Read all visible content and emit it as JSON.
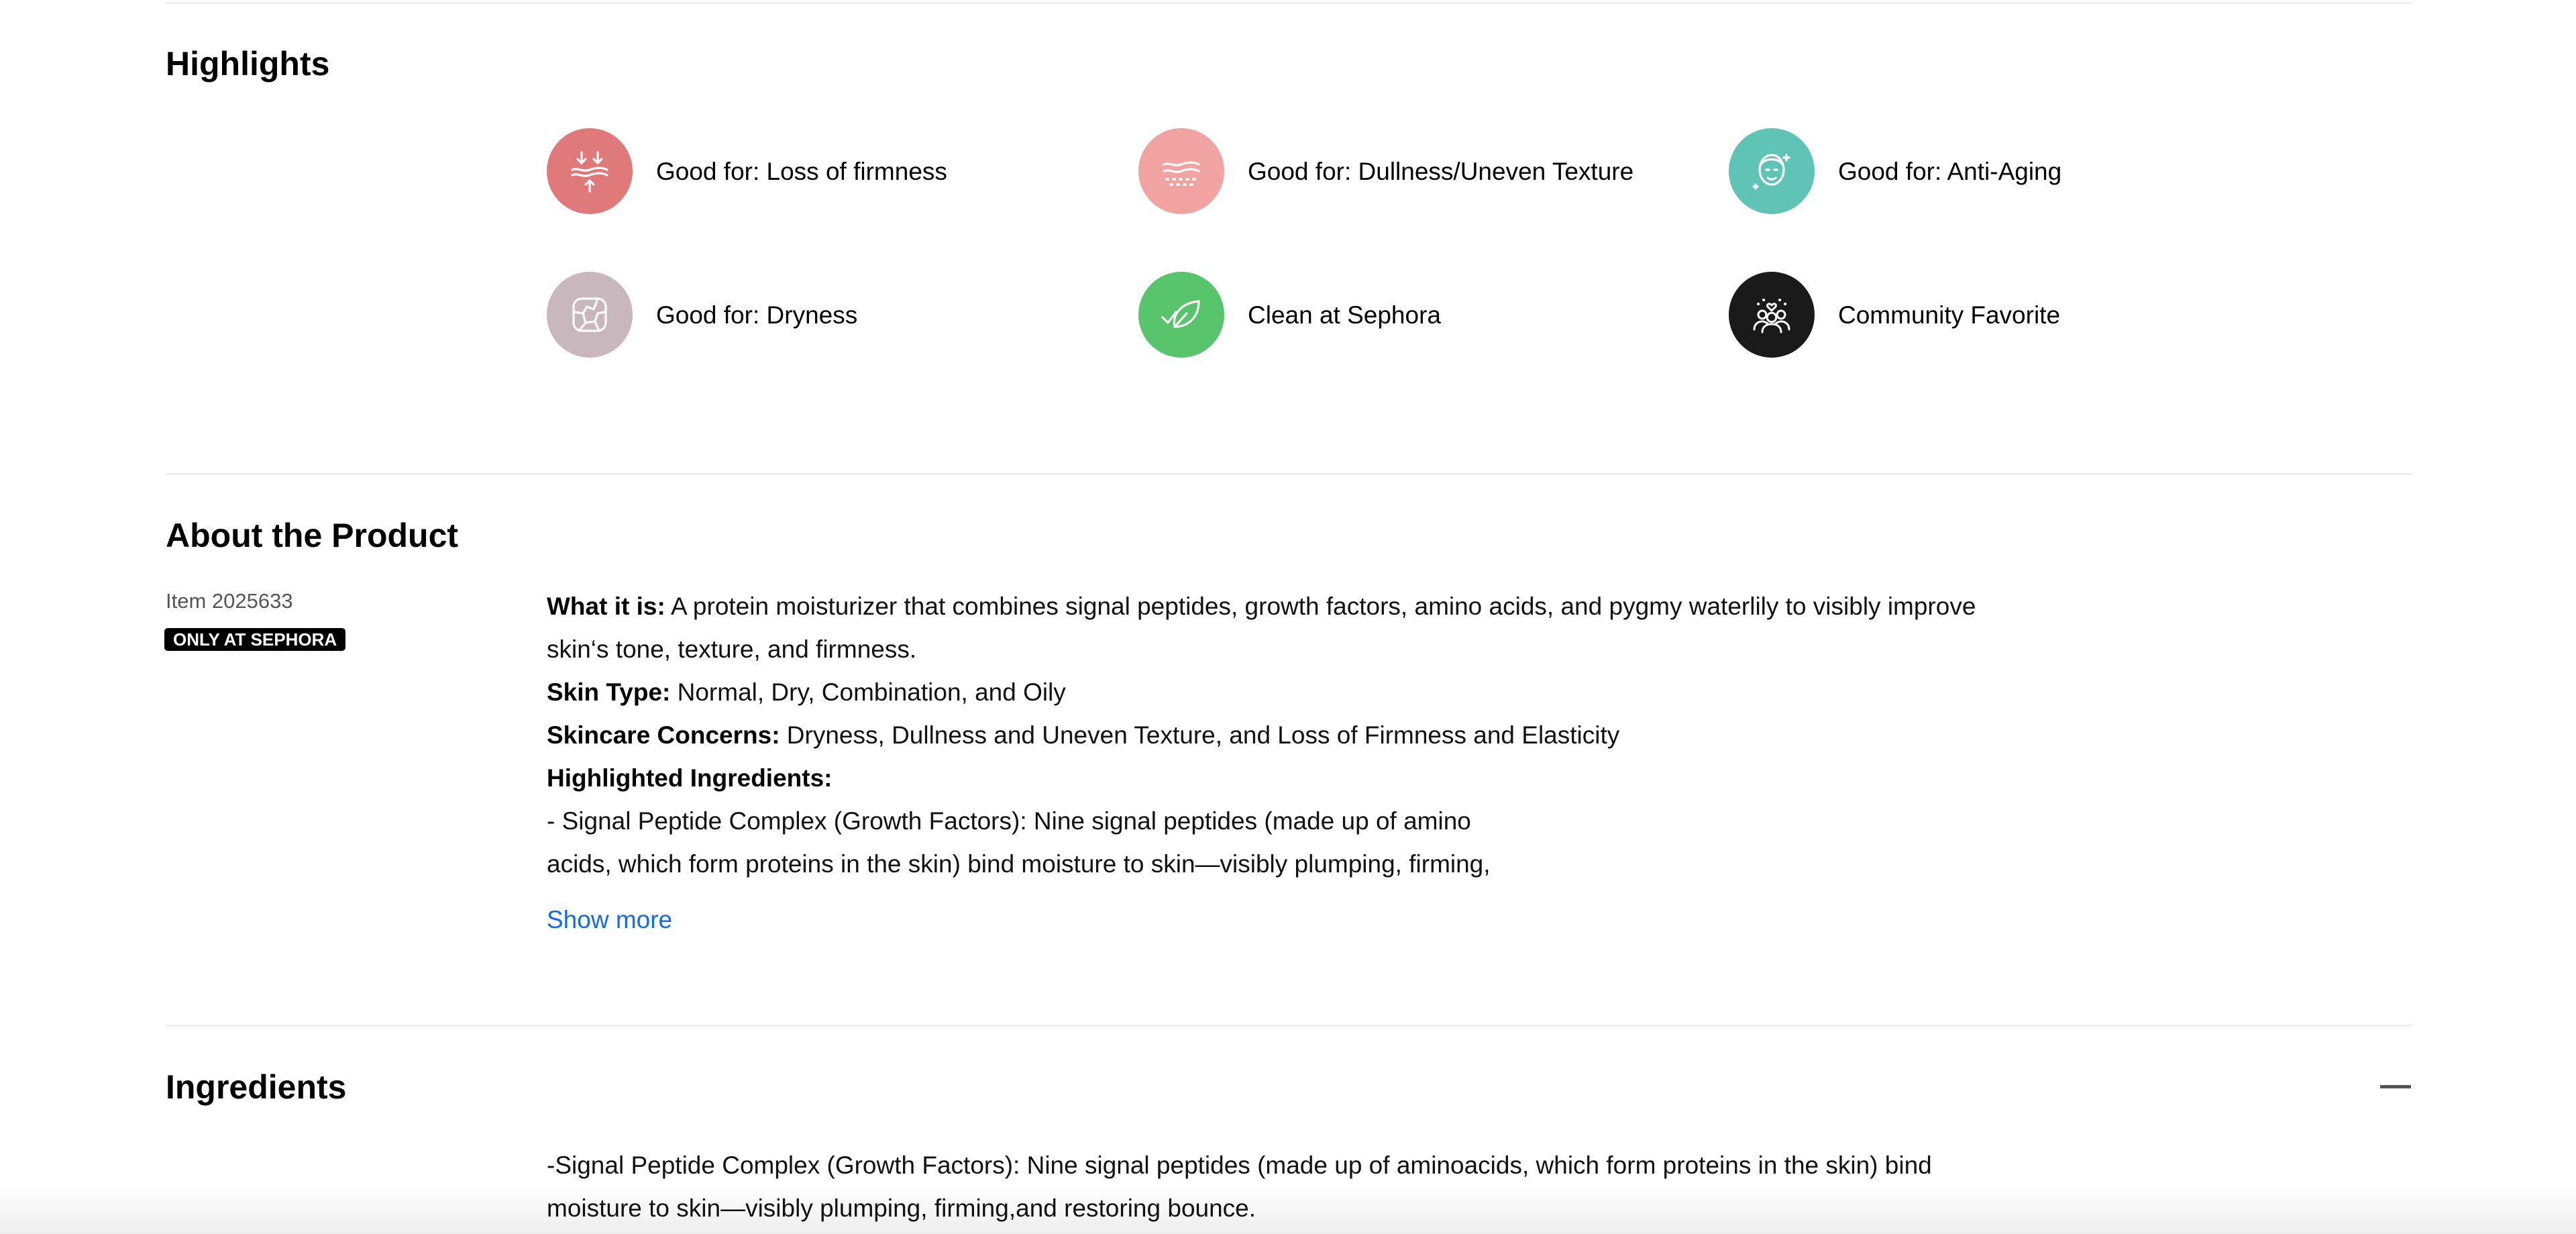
{
  "highlights": {
    "title": "Highlights",
    "items": [
      {
        "label": "Good for: Loss of firmness",
        "icon": "firmness-arrows-icon",
        "color": "#e07a7a"
      },
      {
        "label": "Good for: Dullness/Uneven Texture",
        "icon": "skin-texture-icon",
        "color": "#f0a3a0"
      },
      {
        "label": "Good for: Anti-Aging",
        "icon": "face-sparkle-icon",
        "color": "#5fc4b6"
      },
      {
        "label": "Good for: Dryness",
        "icon": "cracked-skin-icon",
        "color": "#c8b7bd"
      },
      {
        "label": "Clean at Sephora",
        "icon": "leaf-check-icon",
        "color": "#58c46b"
      },
      {
        "label": "Community Favorite",
        "icon": "community-hearts-icon",
        "color": "#1a1a1a"
      }
    ]
  },
  "about": {
    "title": "About the Product",
    "item_number": "Item 2025633",
    "badge": "ONLY AT SEPHORA",
    "what_it_is_label": "What it is:",
    "what_it_is_line1": " A protein moisturizer that combines signal peptides, growth factors, amino acids, and pygmy waterlily to visibly improve",
    "what_it_is_line2": "skin‘s tone, texture, and firmness.",
    "skin_type_label": "Skin Type:",
    "skin_type_value": " Normal, Dry, Combination, and Oily",
    "concerns_label": "Skincare Concerns:",
    "concerns_value": " Dryness, Dullness and Uneven Texture, and Loss of Firmness and Elasticity",
    "ingredients_label": "Highlighted Ingredients:",
    "ingredient_line1": "- Signal Peptide Complex (Growth Factors): Nine signal peptides (made up of amino",
    "ingredient_line2": "acids, which form proteins in the skin) bind moisture to skin—visibly plumping, firming,",
    "show_more": "Show more"
  },
  "ingredients": {
    "title": "Ingredients",
    "line1": "-Signal Peptide Complex (Growth Factors): Nine signal peptides (made up of aminoacids, which form proteins in the skin) bind",
    "line2": "moisture to skin—visibly plumping, firming,and restoring bounce."
  },
  "colors": {
    "link": "#136bea",
    "divider": "#eeeeee",
    "badge_bg": "#000000"
  }
}
